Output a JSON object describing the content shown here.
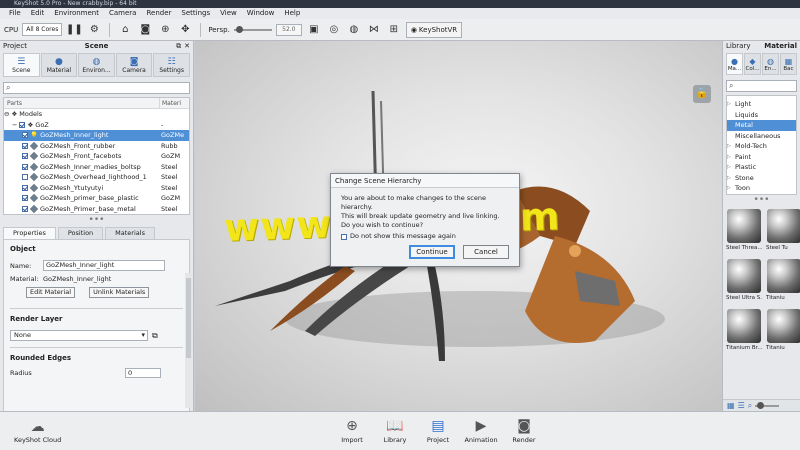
{
  "window": {
    "title": "KeyShot 5.0 Pro - New crabby.bip - 64 bit"
  },
  "menu": [
    "File",
    "Edit",
    "Environment",
    "Camera",
    "Render",
    "Settings",
    "View",
    "Window",
    "Help"
  ],
  "toolbar": {
    "cpu_label": "CPU",
    "cores_value": "All 8 Cores",
    "persp_label": "Persp.",
    "zoom_value": "52.0",
    "keyshotvr_label": "KeyShotVR"
  },
  "left_panel": {
    "project_label": "Project",
    "scene_label": "Scene",
    "tabs": [
      {
        "label": "Scene",
        "icon": "scene-tree-icon"
      },
      {
        "label": "Material",
        "icon": "material-ball-icon"
      },
      {
        "label": "Environ...",
        "icon": "globe-icon"
      },
      {
        "label": "Camera",
        "icon": "camera-icon"
      },
      {
        "label": "Settings",
        "icon": "sliders-icon"
      }
    ],
    "search_placeholder": "",
    "tree": {
      "col_parts": "Parts",
      "col_material": "Materi",
      "rows": [
        {
          "name": "Models",
          "material": ""
        },
        {
          "name": "GoZ",
          "material": "-"
        },
        {
          "name": "GoZMesh_Inner_light",
          "material": "GoZMe"
        },
        {
          "name": "GoZMesh_Front_rubber",
          "material": "Rubb"
        },
        {
          "name": "GoZMesh_Front_facebots",
          "material": "GoZM"
        },
        {
          "name": "GoZMesh_Inner_madies_boltsp",
          "material": "Steel"
        },
        {
          "name": "GoZMesh_Overhead_lighthood_1",
          "material": "Steel"
        },
        {
          "name": "GoZMesh_Ytutyutyi",
          "material": "Steel"
        },
        {
          "name": "GoZMesh_primer_base_plastic",
          "material": "GoZM"
        },
        {
          "name": "GoZMesh_Primer_base_metal",
          "material": "Steel"
        }
      ]
    },
    "subtabs": [
      "Properties",
      "Position",
      "Materials"
    ],
    "object": {
      "section_title": "Object",
      "name_label": "Name:",
      "name_value": "GoZMesh_Inner_light",
      "material_label": "Material:",
      "material_value": "GoZMesh_Inner_light",
      "edit_material": "Edit Material",
      "unlink_materials": "Unlink Materials"
    },
    "render_layer": {
      "section_title": "Render Layer",
      "value": "None"
    },
    "rounded_edges": {
      "section_title": "Rounded Edges",
      "radius_label": "Radius",
      "radius_value": "0"
    }
  },
  "dialog": {
    "title": "Change Scene Hierarchy",
    "line1": "You are about to make changes to the scene hierarchy.",
    "line2": "This will break update geometry and live linking.",
    "line3": "Do you wish to continue?",
    "checkbox_label": "Do not show this message again",
    "continue_label": "Continue",
    "cancel_label": "Cancel"
  },
  "watermark": "www.cgtsj.com",
  "right_panel": {
    "library_label": "Library",
    "material_label": "Material",
    "tabs": [
      {
        "label": "Ma...",
        "icon": "material-ball-icon"
      },
      {
        "label": "Col...",
        "icon": "palette-icon"
      },
      {
        "label": "En...",
        "icon": "globe-icon"
      },
      {
        "label": "Bac",
        "icon": "image-icon"
      }
    ],
    "categories": [
      "Light",
      "Liquids",
      "Metal",
      "Miscellaneous",
      "Mold-Tech",
      "Paint",
      "Plastic",
      "Stone",
      "Toon"
    ],
    "selected_category": "Metal",
    "thumbnails": [
      "Steel Threa...",
      "Steel Tu",
      "Steel Ultra S...",
      "Titaniu",
      "Titanium Br...",
      "Titaniu"
    ]
  },
  "bottom_bar": {
    "cloud_label": "KeyShot Cloud",
    "buttons": [
      "Import",
      "Library",
      "Project",
      "Animation",
      "Render"
    ]
  }
}
